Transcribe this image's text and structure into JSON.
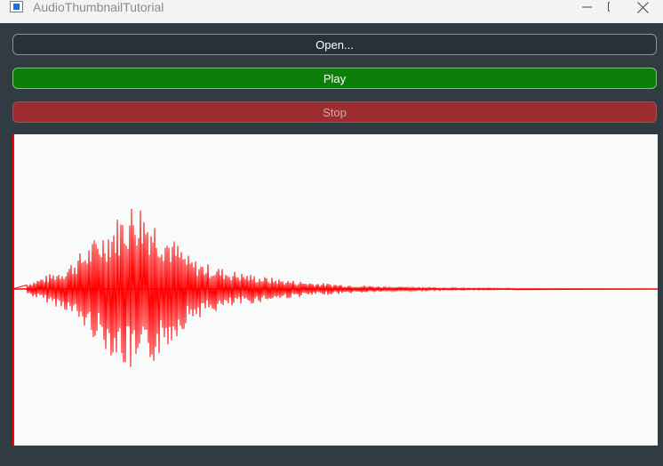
{
  "window": {
    "title": "AudioThumbnailTutorial",
    "controls": [
      "minimize-icon",
      "maximize-icon",
      "close-icon"
    ]
  },
  "buttons": {
    "open_label": "Open...",
    "play_label": "Play",
    "stop_label": "Stop"
  },
  "colors": {
    "background": "#313b42",
    "open_button": "#27313a",
    "play_button": "#0e7e0b",
    "stop_button": "#9d2d2e",
    "waveform": "#ff0000",
    "thumbnail_background": "#f9fbfb"
  },
  "state": {
    "stop_enabled": false
  }
}
